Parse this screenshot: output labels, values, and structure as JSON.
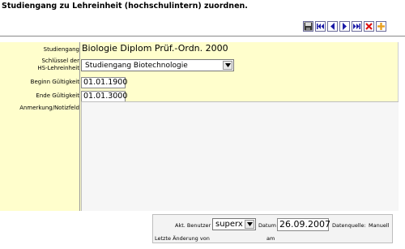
{
  "title": "Studiengang zu Lehreinheit (hochschulintern) zuordnen.",
  "toolbar": {
    "icons": [
      "save-icon",
      "first-record-icon",
      "previous-record-icon",
      "next-record-icon",
      "last-record-icon",
      "delete-icon",
      "new-record-icon"
    ]
  },
  "form": {
    "studiengang_label": "Studiengang",
    "studiengang_value": "Biologie Diplom Prüf.-Ordn. 2000",
    "schluessel_label_line1": "Schlüssel der",
    "schluessel_label_line2": "HS-Lehreinheit",
    "schluessel_value": "Studiengang Biotechnologie",
    "beginn_label": "Beginn Gültigkeit",
    "beginn_value": "01.01.1900",
    "ende_label": "Ende Gültigkeit",
    "ende_value": "01.01.3000",
    "anmerkung_label": "Anmerkung/Notizfeld",
    "anmerkung_value": ""
  },
  "footer": {
    "akt_benutzer_label": "Akt. Benutzer",
    "akt_benutzer_value": "superx",
    "datum_label": "Datum",
    "datum_value": "26.09.2007",
    "datenquelle_label": "Datenquelle:",
    "datenquelle_value": "Manuell",
    "letzte_aenderung_label": "Letzte Änderung von",
    "am_label": "am"
  },
  "colors": {
    "form_background": "#fffecc",
    "toolbar_blue": "#1a1aa8",
    "delete_red": "#dd1111",
    "new_orange": "#e8a020"
  }
}
